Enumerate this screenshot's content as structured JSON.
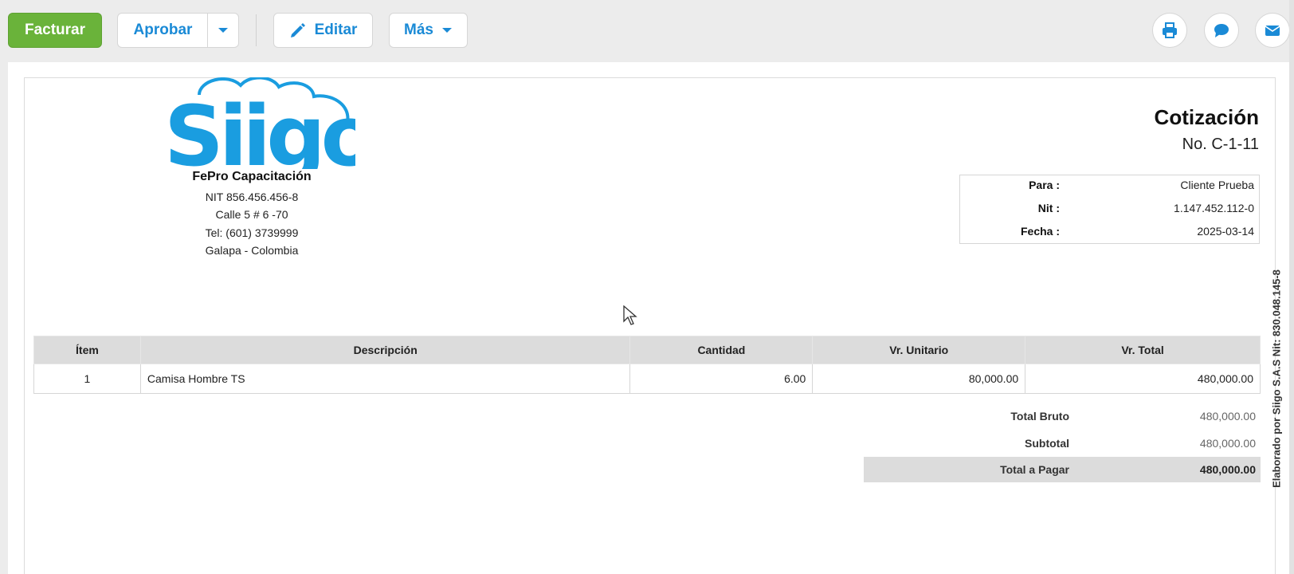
{
  "toolbar": {
    "facturar_label": "Facturar",
    "aprobar_label": "Aprobar",
    "editar_label": "Editar",
    "mas_label": "Más",
    "accent_color": "#1a8ad6",
    "primary_color": "#6ab33a",
    "icons": [
      "caret-down-icon",
      "pencil-icon",
      "printer-icon",
      "comment-icon",
      "envelope-icon"
    ]
  },
  "company": {
    "logo_text": "Siigo",
    "logo_color": "#1a9de0",
    "name": "FePro Capacitación",
    "nit": "NIT 856.456.456-8",
    "address": "Calle 5 # 6 -70",
    "phone": "Tel: (601) 3739999",
    "city": "Galapa - Colombia"
  },
  "document": {
    "title": "Cotización",
    "number": "No. C-1-11",
    "info": [
      {
        "label": "Para :",
        "value": "Cliente Prueba"
      },
      {
        "label": "Nit :",
        "value": "1.147.452.112-0"
      },
      {
        "label": "Fecha :",
        "value": "2025-03-14"
      }
    ]
  },
  "items_table": {
    "headers": [
      "Ítem",
      "Descripción",
      "Cantidad",
      "Vr. Unitario",
      "Vr. Total"
    ],
    "rows": [
      {
        "item": "1",
        "description": "Camisa Hombre TS",
        "quantity": "6.00",
        "unit_price": "80,000.00",
        "total": "480,000.00"
      }
    ]
  },
  "totals": [
    {
      "label": "Total Bruto",
      "value": "480,000.00"
    },
    {
      "label": "Subtotal",
      "value": "480,000.00"
    },
    {
      "label": "Total a Pagar",
      "value": "480,000.00"
    }
  ],
  "footer": {
    "vertical_text": "Elaborado por Siigo S.A.S Nit: 830.048.145-8"
  }
}
